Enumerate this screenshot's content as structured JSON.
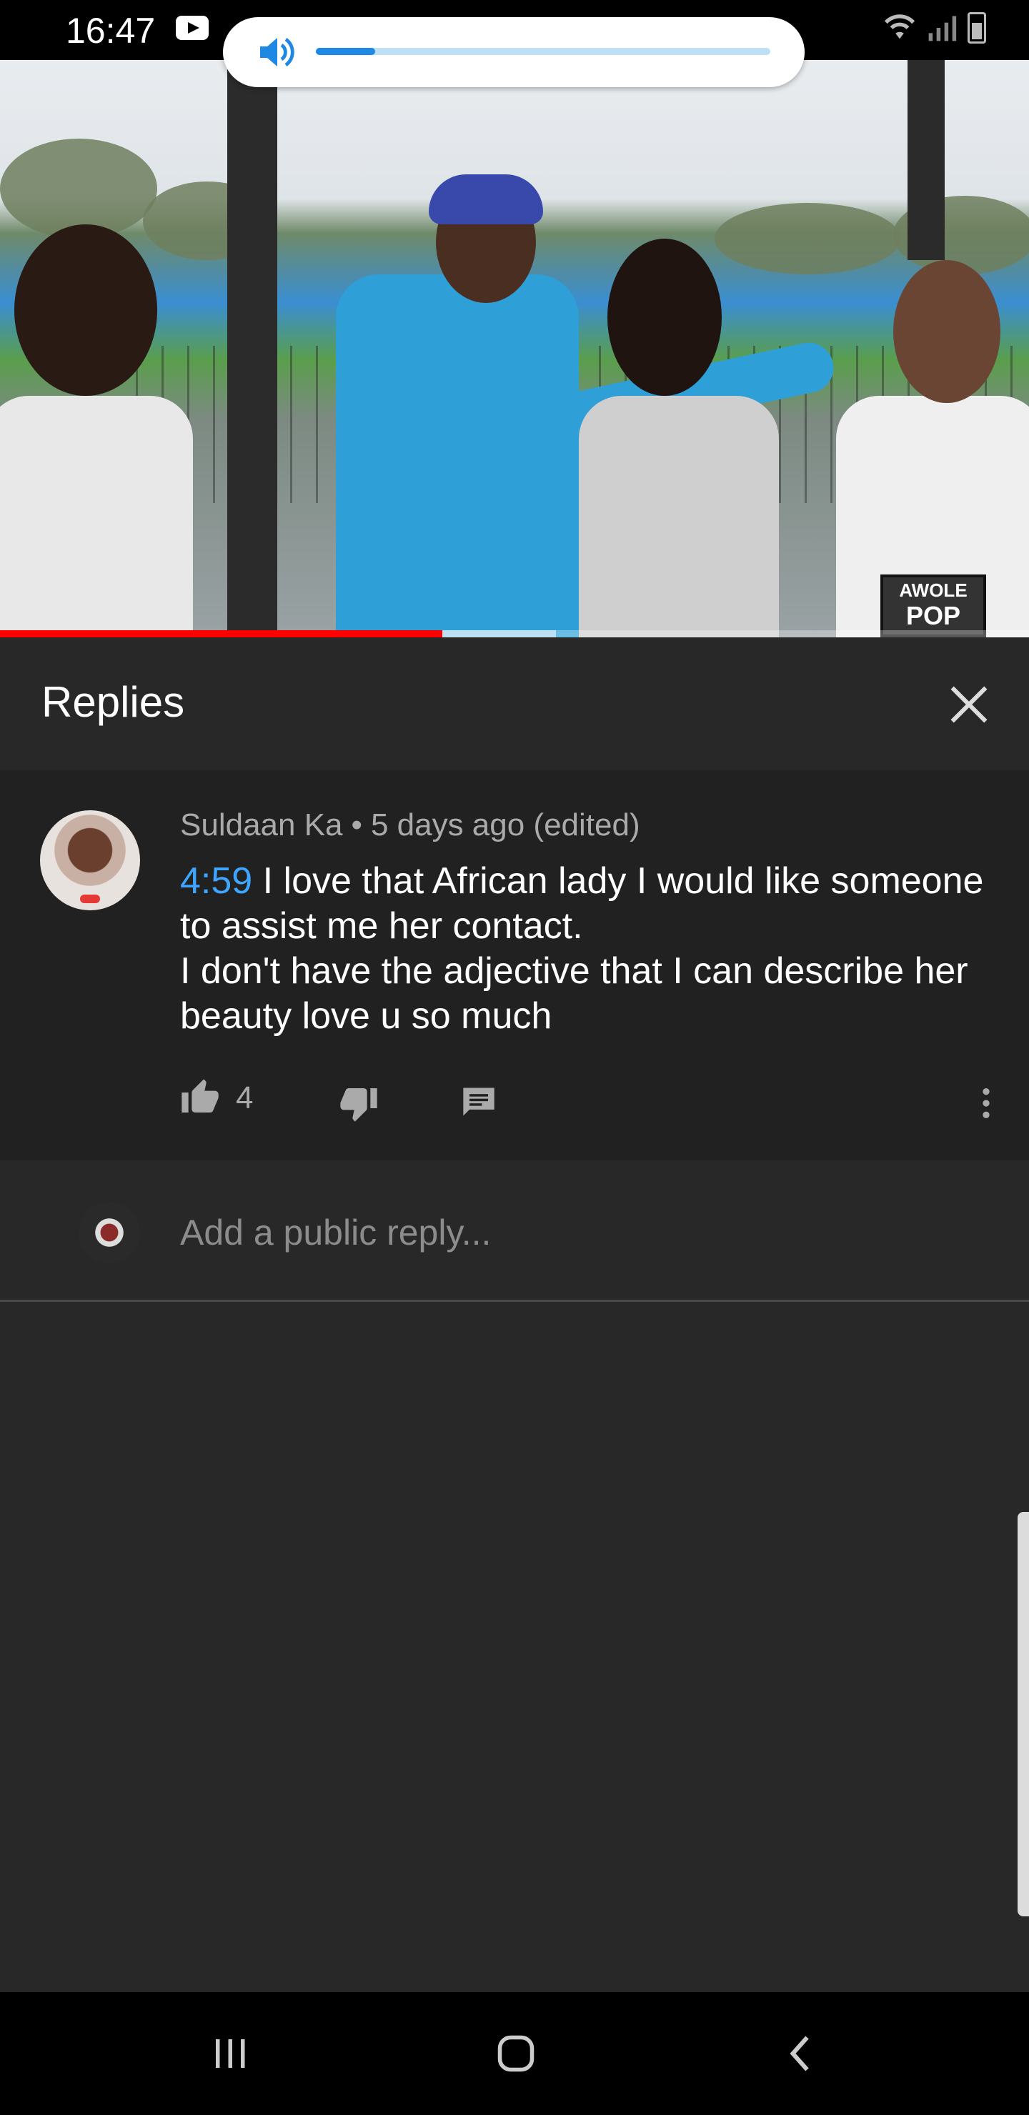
{
  "status_bar": {
    "time": "16:47",
    "icons": [
      "youtube-icon",
      "wifi-icon",
      "signal-icon",
      "battery-icon"
    ]
  },
  "volume": {
    "icon": "speaker-icon",
    "level": 0.13,
    "accent": "#1e88e5"
  },
  "video": {
    "progress": 0.43,
    "buffered": 0.54,
    "progress_color": "#ff0000",
    "watermark_top": "AWOLE",
    "watermark_bottom": "POP"
  },
  "replies": {
    "title": "Replies",
    "close_icon": "close-icon"
  },
  "comment": {
    "author": "Suldaan Ka",
    "separator": "•",
    "age": "5 days ago (edited)",
    "timestamp_link": "4:59",
    "text": " I love that African lady I would like someone to assist me her contact.\nI don't have the adjective that I can describe her beauty love u so much",
    "timestamp_color": "#3ea6ff",
    "like_count": "4",
    "icons": [
      "thumbs-up-icon",
      "thumbs-down-icon",
      "reply-icon",
      "more-vert-icon"
    ]
  },
  "add_reply": {
    "placeholder": "Add a public reply..."
  },
  "nav": {
    "icons": [
      "recents-icon",
      "home-icon",
      "back-icon"
    ]
  }
}
